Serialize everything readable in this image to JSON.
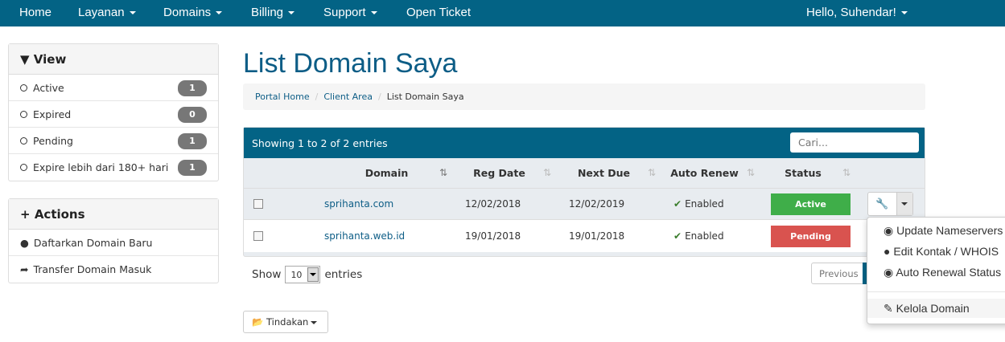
{
  "nav": {
    "items": [
      {
        "label": "Home"
      },
      {
        "label": "Layanan"
      },
      {
        "label": "Domains"
      },
      {
        "label": "Billing"
      },
      {
        "label": "Support"
      },
      {
        "label": "Open Ticket"
      }
    ],
    "user": "Hello, Suhendar!"
  },
  "sidebar": {
    "view": {
      "title": "View",
      "items": [
        {
          "label": "Active",
          "count": "1"
        },
        {
          "label": "Expired",
          "count": "0"
        },
        {
          "label": "Pending",
          "count": "1"
        },
        {
          "label": "Expire lebih dari 180+ hari",
          "count": "1"
        }
      ]
    },
    "actions": {
      "title": "Actions",
      "items": [
        {
          "label": "Daftarkan Domain Baru"
        },
        {
          "label": "Transfer Domain Masuk"
        }
      ]
    }
  },
  "page": {
    "title": "List Domain Saya",
    "breadcrumb": [
      "Portal Home",
      "Client Area",
      "List Domain Saya"
    ]
  },
  "table": {
    "info": "Showing 1 to 2 of 2 entries",
    "search_placeholder": "Cari...",
    "columns": [
      "Domain",
      "Reg Date",
      "Next Due",
      "Auto Renew",
      "Status"
    ],
    "rows": [
      {
        "domain": "sprihanta.com",
        "reg": "12/02/2018",
        "due": "12/02/2019",
        "renew": "Enabled",
        "status": "Active",
        "status_color": "#3fae49"
      },
      {
        "domain": "sprihanta.web.id",
        "reg": "19/01/2018",
        "due": "19/01/2018",
        "renew": "Enabled",
        "status": "Pending",
        "status_color": "#d9534f"
      }
    ],
    "show": "Show",
    "length": "10",
    "entries": "entries",
    "previous": "Previous"
  },
  "dropdown": {
    "items": [
      "Update Nameservers",
      "Edit Kontak / WHOIS",
      "Auto Renewal Status",
      "Kelola Domain"
    ]
  },
  "bulk": {
    "label": "Tindakan"
  }
}
